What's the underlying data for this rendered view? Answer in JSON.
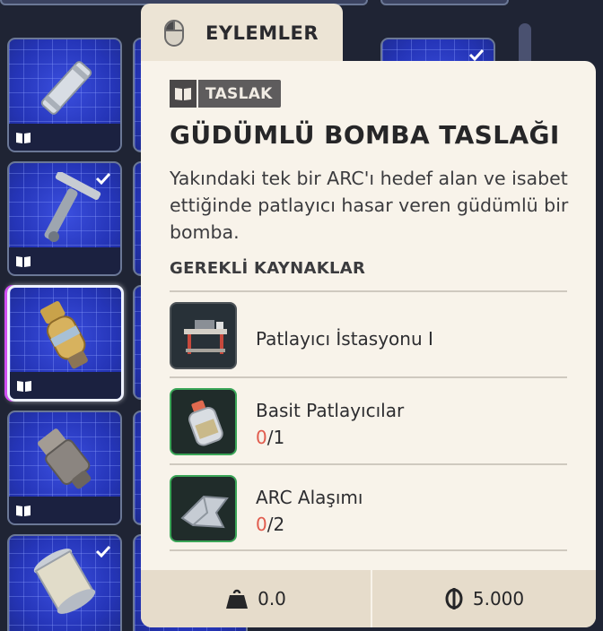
{
  "inventory": {
    "slots": [
      {
        "item": "canister-icon",
        "blueprint": true,
        "checked": false
      },
      {
        "item": "turret-arm-icon",
        "blueprint": true,
        "checked": true
      },
      {
        "item": "guided-bomb-icon",
        "blueprint": true,
        "checked": false,
        "selected": true
      },
      {
        "item": "grenade-shell-icon",
        "blueprint": true,
        "checked": false
      },
      {
        "item": "cage-canister-icon",
        "blueprint": true,
        "checked": true
      }
    ]
  },
  "actions_tab": {
    "label": "EYLEMLER",
    "icon": "mouse-icon"
  },
  "tooltip": {
    "badge": "TASLAK",
    "title": "GÜDÜMLÜ BOMBA TASLAĞI",
    "description": "Yakındaki tek bir ARC'ı hedef alan ve isabet ettiğinde patlayıcı hasar veren güdümlü bir bomba.",
    "requirements_heading": "GEREKLİ KAYNAKLAR",
    "requirements": [
      {
        "name": "Patlayıcı İstasyonu I",
        "icon": "workbench-icon"
      },
      {
        "name": "Basit Patlayıcılar",
        "have": "0",
        "need": "/1",
        "icon": "explosive-bottle-icon"
      },
      {
        "name": "ARC Alaşımı",
        "have": "0",
        "need": "/2",
        "icon": "arc-alloy-icon"
      }
    ],
    "weight": "0.0",
    "price": "5.000"
  },
  "colors": {
    "card_bg": "#f8f3ea",
    "footer_bg": "#e6dccb",
    "missing_count": "#e15b4d",
    "rarity_green": "#3aa557",
    "slot_blue": "#2535b8"
  }
}
